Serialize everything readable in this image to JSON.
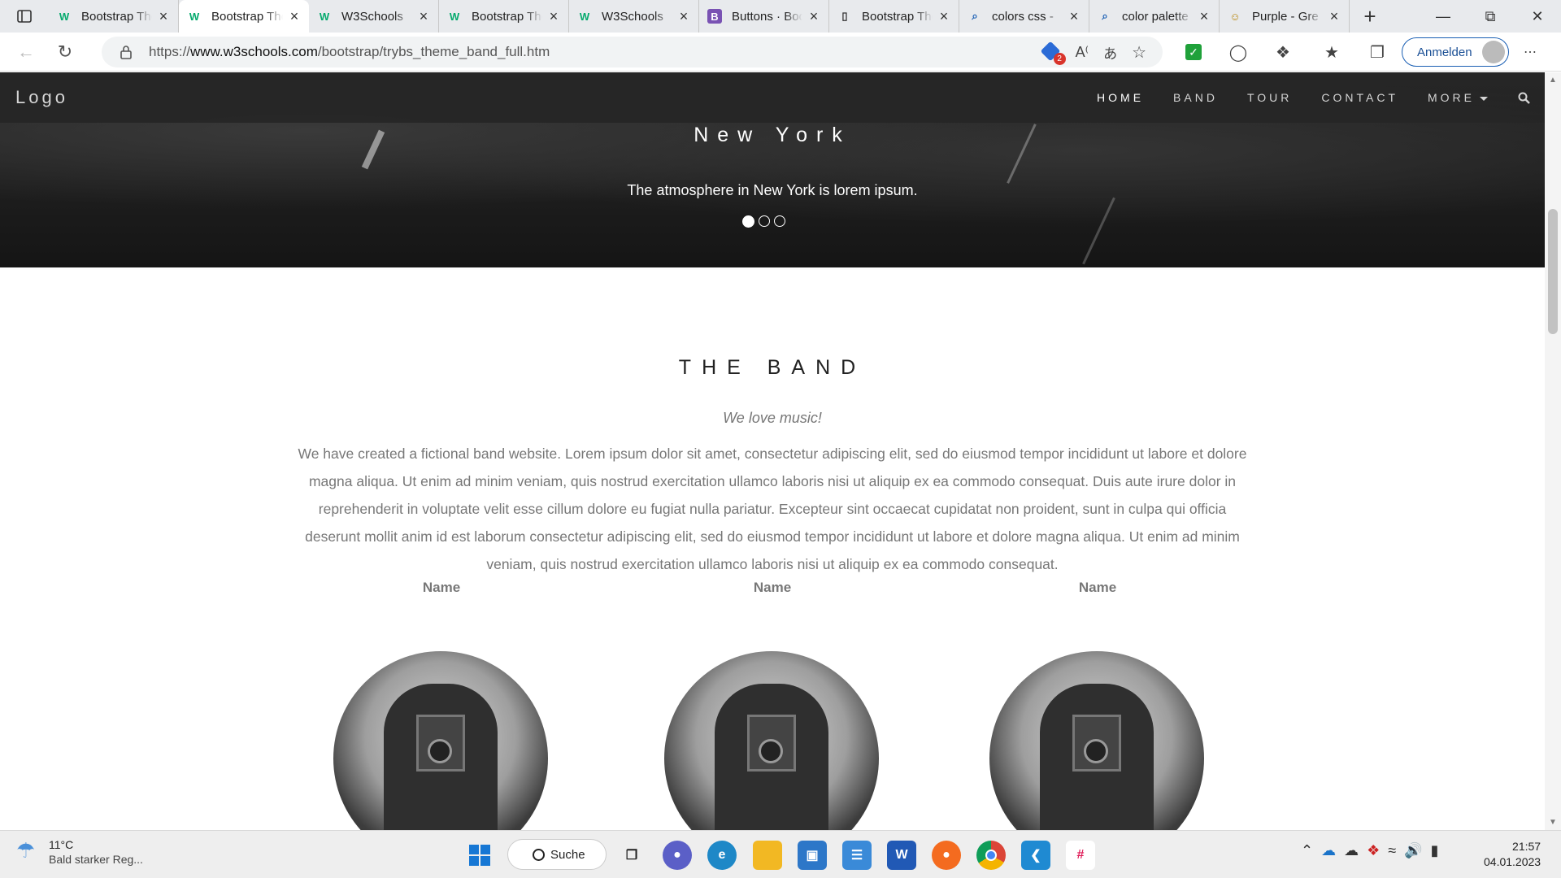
{
  "browser": {
    "tabs": [
      {
        "title": "Bootstrap Theme",
        "favicon": "w3schools-icon",
        "active": false
      },
      {
        "title": "Bootstrap Theme",
        "favicon": "w3schools-icon",
        "active": true
      },
      {
        "title": "W3Schools",
        "favicon": "w3schools-icon",
        "active": false
      },
      {
        "title": "Bootstrap Theme",
        "favicon": "w3schools-icon",
        "active": false
      },
      {
        "title": "W3Schools",
        "favicon": "w3schools-icon",
        "active": false
      },
      {
        "title": "Buttons · Bootstrap",
        "favicon": "bootstrap-icon",
        "active": false
      },
      {
        "title": "Bootstrap Theme",
        "favicon": "page-icon",
        "active": false
      },
      {
        "title": "colors css -",
        "favicon": "search-icon",
        "active": false
      },
      {
        "title": "color palette",
        "favicon": "search-icon",
        "active": false
      },
      {
        "title": "Purple - Gre",
        "favicon": "person-icon",
        "active": false
      }
    ],
    "url_prefix": "https://",
    "url_host": "www.w3schools.com",
    "url_path": "/bootstrap/trybs_theme_band_full.htm",
    "signin_label": "Anmelden",
    "notification_count": "2"
  },
  "site": {
    "logo": "Logo",
    "nav": [
      "HOME",
      "BAND",
      "TOUR",
      "CONTACT",
      "MORE"
    ],
    "hero_title": "New York",
    "hero_subtitle": "The atmosphere in New York is lorem ipsum.",
    "carousel_active_index": 0,
    "carousel_count": 3,
    "band_title": "THE BAND",
    "tagline": "We love music!",
    "description": "We have created a fictional band website. Lorem ipsum dolor sit amet, consectetur adipiscing elit, sed do eiusmod tempor incididunt ut labore et dolore magna aliqua. Ut enim ad minim veniam, quis nostrud exercitation ullamco laboris nisi ut aliquip ex ea commodo consequat. Duis aute irure dolor in reprehenderit in voluptate velit esse cillum dolore eu fugiat nulla pariatur. Excepteur sint occaecat cupidatat non proident, sunt in culpa qui officia deserunt mollit anim id est laborum consectetur adipiscing elit, sed do eiusmod tempor incididunt ut labore et dolore magna aliqua. Ut enim ad minim veniam, quis nostrud exercitation ullamco laboris nisi ut aliquip ex ea commodo consequat.",
    "members": [
      {
        "name": "Name"
      },
      {
        "name": "Name"
      },
      {
        "name": "Name"
      }
    ]
  },
  "taskbar": {
    "temperature": "11°C",
    "weather_text": "Bald starker Reg...",
    "search_label": "Suche",
    "time": "21:57",
    "date": "04.01.2023"
  },
  "colors": {
    "nav_bg": "#262626",
    "accent_blue": "#1a5fb4",
    "text_muted": "#777777"
  }
}
